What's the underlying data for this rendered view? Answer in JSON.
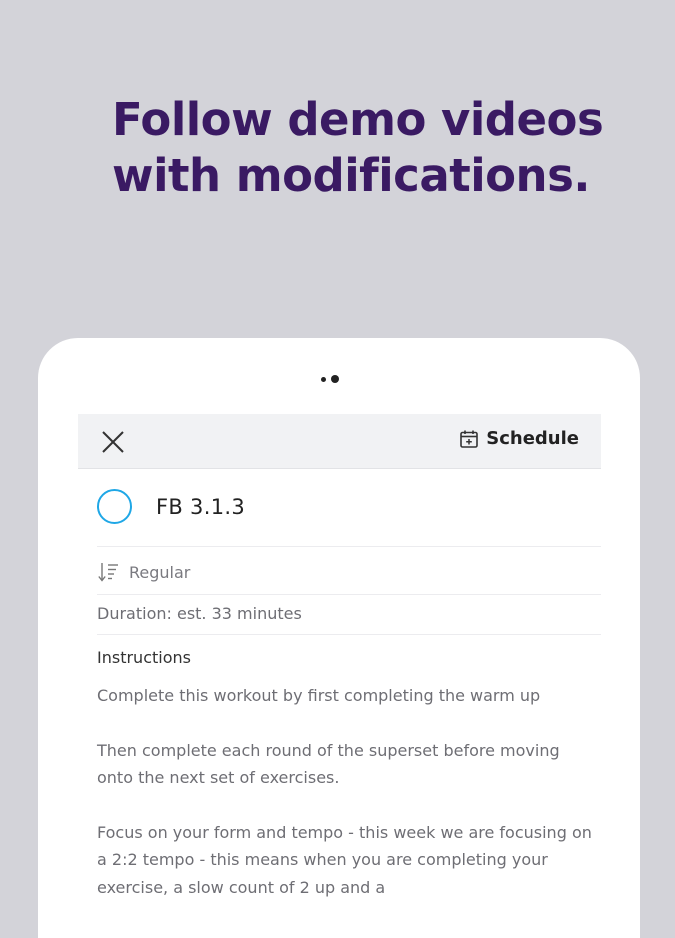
{
  "headline": {
    "line1": "Follow demo videos",
    "line2": "with modifications."
  },
  "pager": {
    "count": 2,
    "active": 2
  },
  "toolbar": {
    "close_icon": "close-icon",
    "schedule_label": "Schedule",
    "schedule_icon": "calendar-add-icon"
  },
  "workout": {
    "title": "FB 3.1.3",
    "status_icon": "incomplete-circle-icon",
    "type_label": "Regular",
    "type_icon": "sort-icon",
    "duration": "Duration: est. 33 minutes"
  },
  "instructions": {
    "heading": "Instructions",
    "paragraphs": [
      "Complete this workout by first completing the warm up",
      "Then complete each round of the superset before moving onto the next set of exercises.",
      "Focus on your form and tempo - this week we are focusing on a 2:2 tempo - this means when you are completing your exercise, a slow count of 2 up and a"
    ]
  },
  "colors": {
    "background": "#d3d3d9",
    "headline": "#3a1a63",
    "accent": "#1fa7e6"
  }
}
